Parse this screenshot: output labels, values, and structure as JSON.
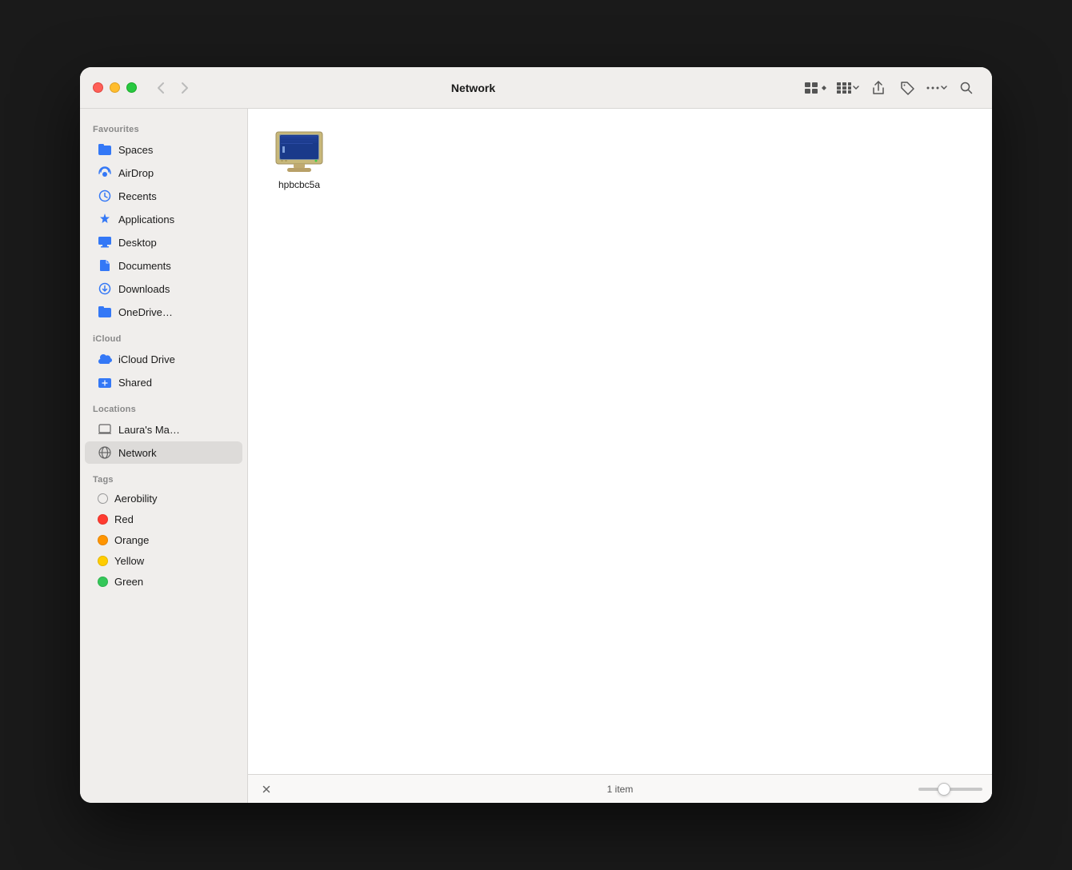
{
  "window": {
    "title": "Network"
  },
  "titlebar": {
    "back_label": "‹",
    "forward_label": "›",
    "view_icon": "⊞",
    "view_dropdown": "⌄",
    "share_icon": "↑",
    "tag_icon": "◇",
    "more_icon": "•••",
    "search_icon": "⌕"
  },
  "sidebar": {
    "sections": [
      {
        "label": "Favourites",
        "items": [
          {
            "id": "spaces",
            "label": "Spaces",
            "icon": "folder-blue",
            "type": "folder"
          },
          {
            "id": "airdrop",
            "label": "AirDrop",
            "icon": "airdrop",
            "type": "airdrop"
          },
          {
            "id": "recents",
            "label": "Recents",
            "icon": "clock",
            "type": "clock"
          },
          {
            "id": "applications",
            "label": "Applications",
            "icon": "applications",
            "type": "applications"
          },
          {
            "id": "desktop",
            "label": "Desktop",
            "icon": "desktop",
            "type": "desktop"
          },
          {
            "id": "documents",
            "label": "Documents",
            "icon": "doc",
            "type": "doc"
          },
          {
            "id": "downloads",
            "label": "Downloads",
            "icon": "downloads",
            "type": "downloads"
          },
          {
            "id": "onedrive",
            "label": "OneDrive…",
            "icon": "folder-blue",
            "type": "folder"
          }
        ]
      },
      {
        "label": "iCloud",
        "items": [
          {
            "id": "icloud-drive",
            "label": "iCloud Drive",
            "icon": "cloud",
            "type": "cloud"
          },
          {
            "id": "shared",
            "label": "Shared",
            "icon": "shared",
            "type": "shared"
          }
        ]
      },
      {
        "label": "Locations",
        "items": [
          {
            "id": "lauras-mac",
            "label": "Laura's Ma…",
            "icon": "laptop",
            "type": "laptop"
          },
          {
            "id": "network",
            "label": "Network",
            "icon": "network",
            "type": "network"
          }
        ]
      },
      {
        "label": "Tags",
        "items": [
          {
            "id": "tag-aerobility",
            "label": "Aerobility",
            "icon": "tag-none",
            "type": "tag-none"
          },
          {
            "id": "tag-red",
            "label": "Red",
            "icon": "tag-red",
            "type": "tag-red"
          },
          {
            "id": "tag-orange",
            "label": "Orange",
            "icon": "tag-orange",
            "type": "tag-orange"
          },
          {
            "id": "tag-yellow",
            "label": "Yellow",
            "icon": "tag-yellow",
            "type": "tag-yellow"
          },
          {
            "id": "tag-green",
            "label": "Green",
            "icon": "tag-green",
            "type": "tag-green"
          }
        ]
      }
    ]
  },
  "content": {
    "files": [
      {
        "id": "hpbcbc5a",
        "name": "hpbcbc5a",
        "type": "computer"
      }
    ]
  },
  "statusbar": {
    "count": "1 item",
    "close_icon": "✕"
  }
}
